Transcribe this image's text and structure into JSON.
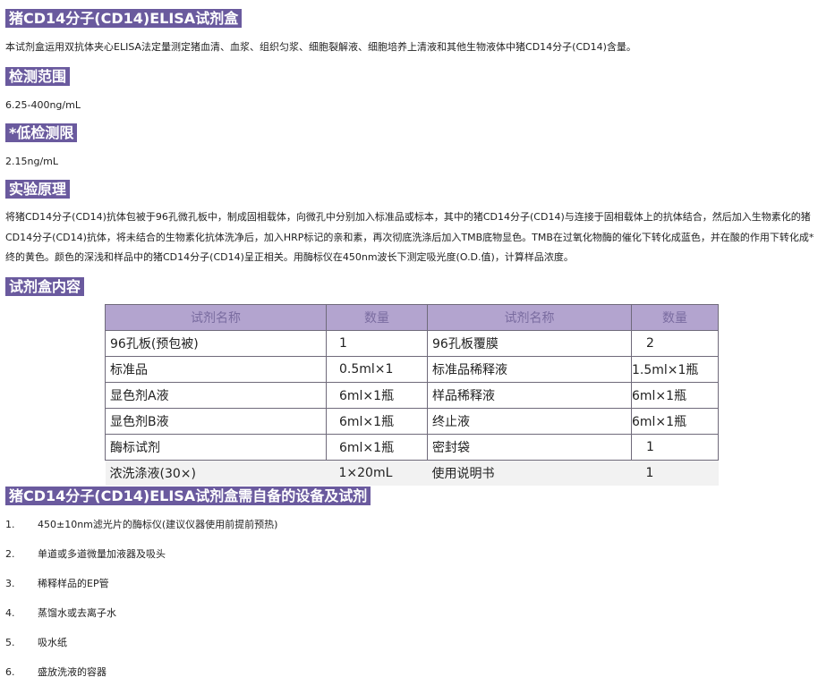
{
  "title": "猪CD14分子(CD14)ELISA试剂盒",
  "intro": "本试剂盒运用双抗体夹心ELISA法定量测定猪血清、血浆、组织匀浆、细胞裂解液、细胞培养上清液和其他生物液体中猪CD14分子(CD14)含量。",
  "range": {
    "heading": "检测范围",
    "value": "6.25-400ng/mL"
  },
  "limit": {
    "heading": "*低检测限",
    "value": "2.15ng/mL"
  },
  "principle": {
    "heading": "实验原理",
    "text": "将猪CD14分子(CD14)抗体包被于96孔微孔板中，制成固相载体，向微孔中分别加入标准品或标本，其中的猪CD14分子(CD14)与连接于固相载体上的抗体结合，然后加入生物素化的猪CD14分子(CD14)抗体，将未结合的生物素化抗体洗净后，加入HRP标记的亲和素，再次彻底洗涤后加入TMB底物显色。TMB在过氧化物酶的催化下转化成蓝色，并在酸的作用下转化成*终的黄色。颜色的深浅和样品中的猪CD14分子(CD14)呈正相关。用酶标仪在450nm波长下测定吸光度(O.D.值)，计算样品浓度。"
  },
  "kit": {
    "heading": "试剂盒内容",
    "headers": [
      "试剂名称",
      "数量",
      "试剂名称",
      "数量"
    ],
    "rows": [
      [
        "96孔板(预包被)",
        "1",
        "96孔板覆膜",
        "2"
      ],
      [
        "标准品",
        "0.5ml×1",
        "标准品稀释液",
        "1.5ml×1瓶"
      ],
      [
        "显色剂A液",
        "6ml×1瓶",
        "样品稀释液",
        "6ml×1瓶"
      ],
      [
        "显色剂B液",
        "6ml×1瓶",
        "终止液",
        "6ml×1瓶"
      ],
      [
        "酶标试剂",
        "6ml×1瓶",
        "密封袋",
        "1"
      ],
      [
        "浓洗涤液(30×)",
        "1×20mL",
        "使用说明书",
        "1"
      ]
    ]
  },
  "equipment": {
    "heading": "猪CD14分子(CD14)ELISA试剂盒需自备的设备及试剂",
    "items": [
      "450±10nm滤光片的酶标仪(建议仪器使用前提前预热)",
      "单道或多道微量加液器及吸头",
      "稀释样品的EP管",
      "蒸馏水或去离子水",
      "吸水纸",
      "盛放洗液的容器"
    ]
  }
}
